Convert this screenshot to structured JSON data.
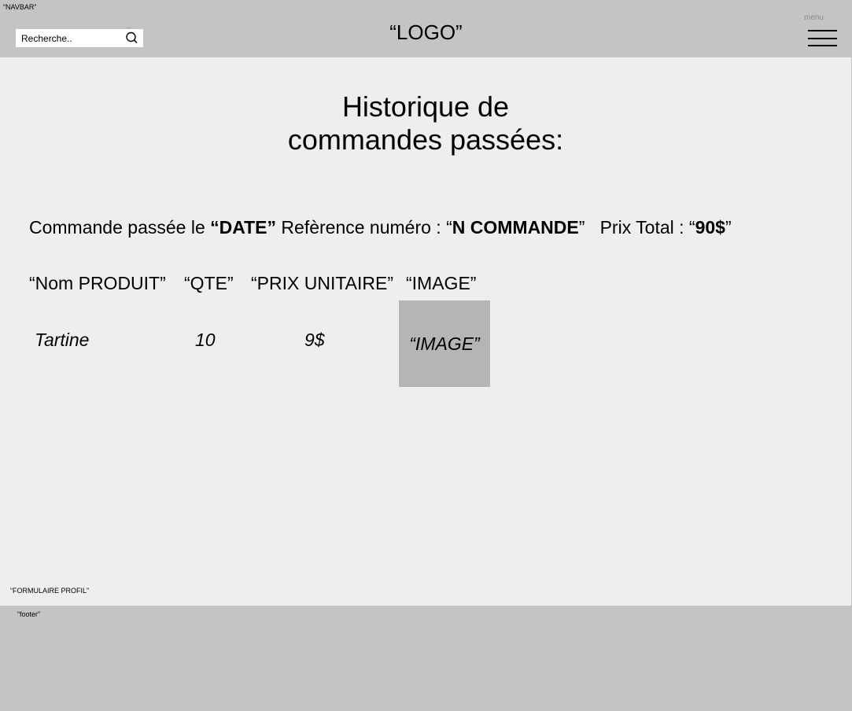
{
  "navbar": {
    "tag": "“NAVBAR”",
    "search": {
      "placeholder": "Recherche..",
      "dots": "..."
    },
    "logo": "“LOGO”",
    "menu_label": "menu"
  },
  "main": {
    "title_line1": "Historique de",
    "title_line2": "commandes passées:",
    "order": {
      "prefix": "Commande passée le ",
      "date": "“DATE”",
      "ref_prefix": " Refèrence numéro : “",
      "ref": "N COMMANDE",
      "ref_suffix": "”   Prix Total : “",
      "total": "90$",
      "total_suffix": "”"
    },
    "table": {
      "headers": [
        "“Nom PRODUIT”",
        "“QTE”",
        "“PRIX UNITAIRE”",
        "“IMAGE”"
      ],
      "rows": [
        {
          "name": "Tartine",
          "qty": "10",
          "unit_price": "9$",
          "image": "“IMAGE”"
        }
      ]
    },
    "profil_tag": "“FORMULAIRE PROFIL”"
  },
  "footer": {
    "tag": "“footer”"
  },
  "colors": {
    "navbar_bg": "#c4c4c4",
    "main_bg": "#eeeeee",
    "image_placeholder": "#b5b5b5"
  }
}
